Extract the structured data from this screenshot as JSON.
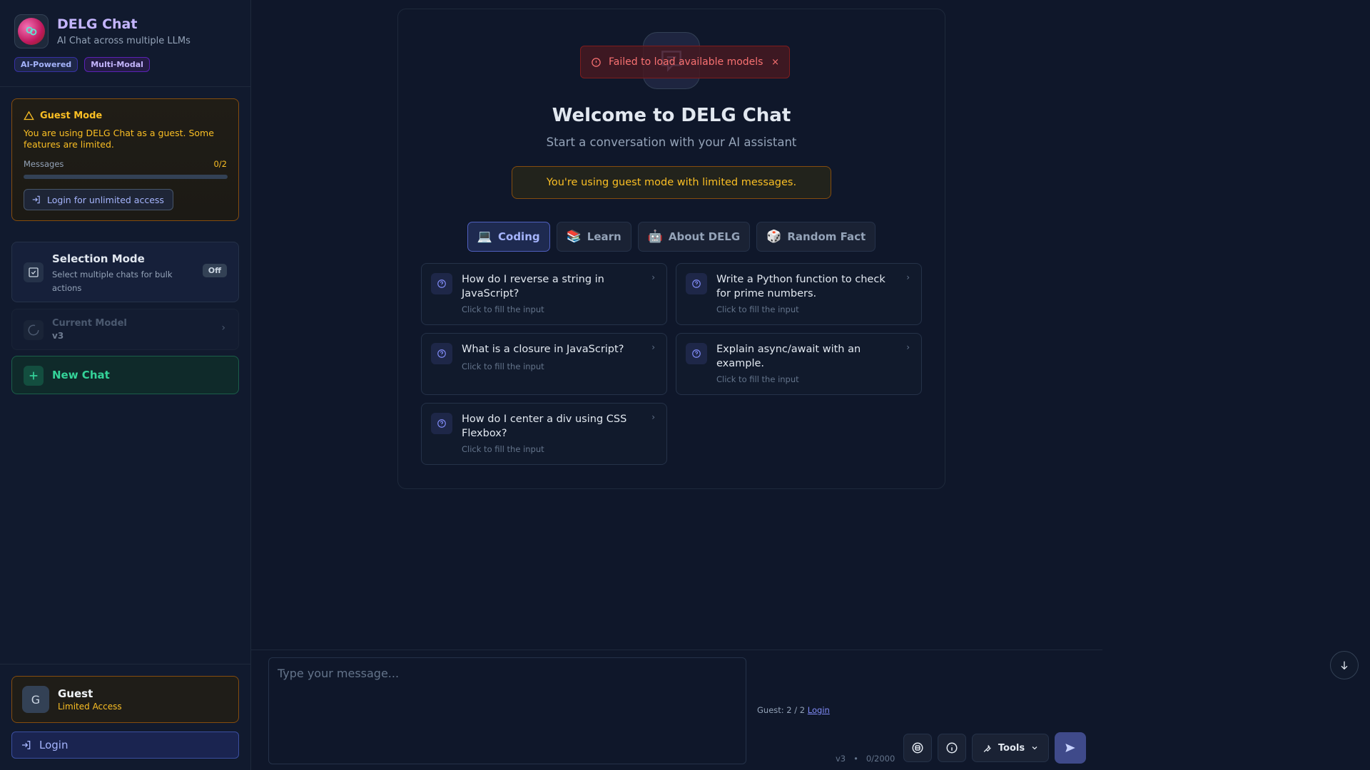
{
  "app": {
    "title": "DELG Chat",
    "subtitle": "AI Chat across multiple LLMs",
    "badges": [
      "AI-Powered",
      "Multi-Modal"
    ]
  },
  "guest_card": {
    "title": "Guest Mode",
    "description": "You are using DELG Chat as a guest. Some features are limited.",
    "messages_label": "Messages",
    "messages_count": "0/2",
    "messages_progress": 0,
    "login_button": "Login for unlimited access"
  },
  "selection_mode": {
    "title": "Selection Mode",
    "subtitle": "Select multiple chats for bulk actions",
    "toggle": "Off"
  },
  "current_model": {
    "label": "Current Model",
    "value": "v3"
  },
  "new_chat": {
    "label": "New Chat"
  },
  "user": {
    "avatar_initial": "G",
    "name": "Guest",
    "access": "Limited Access",
    "login_button": "Login"
  },
  "toast": {
    "message": "Failed to load available models",
    "close": "×"
  },
  "welcome": {
    "title": "Welcome to DELG Chat",
    "subtitle": "Start a conversation with your AI assistant",
    "guest_notice": "You're using guest mode with limited messages."
  },
  "tabs": [
    {
      "emoji": "💻",
      "label": "Coding",
      "active": true
    },
    {
      "emoji": "📚",
      "label": "Learn",
      "active": false
    },
    {
      "emoji": "🤖",
      "label": "About DELG",
      "active": false
    },
    {
      "emoji": "🎲",
      "label": "Random Fact",
      "active": false
    }
  ],
  "prompts": [
    {
      "text": "How do I reverse a string in JavaScript?",
      "hint": "Click to fill the input"
    },
    {
      "text": "Write a Python function to check for prime numbers.",
      "hint": "Click to fill the input"
    },
    {
      "text": "What is a closure in JavaScript?",
      "hint": "Click to fill the input"
    },
    {
      "text": "Explain async/await with an example.",
      "hint": "Click to fill the input"
    },
    {
      "text": "How do I center a div using CSS Flexbox?",
      "hint": "Click to fill the input"
    }
  ],
  "composer": {
    "placeholder": "Type your message...",
    "guest_quota_text": "Guest: 2 / 2",
    "guest_quota_link": "Login",
    "model": "v3",
    "separator": "•",
    "char_count": "0/2000",
    "tools_label": "Tools"
  },
  "colors": {
    "background": "#0f172a",
    "accent": "#a5b4fc",
    "warning": "#fbbf24",
    "error": "#f87171",
    "success": "#34d399"
  },
  "icons": {
    "warning": "triangle-alert-icon",
    "login": "login-icon",
    "checkbox": "checkbox-icon",
    "spinner": "loading-icon",
    "plus": "plus-icon",
    "error": "circle-alert-icon",
    "chat": "message-square-icon",
    "help": "help-circle-icon",
    "send": "send-icon",
    "wrench": "wrench-icon",
    "info": "info-icon",
    "arrow-down": "arrow-down-icon"
  }
}
